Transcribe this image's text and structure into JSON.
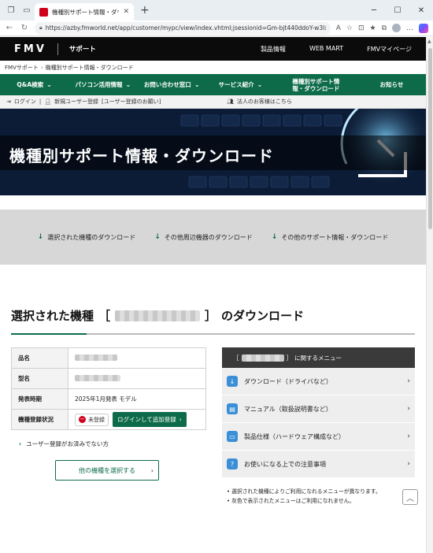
{
  "browser": {
    "tab_title": "機種別サポート情報・ダウンロード - FM",
    "url": "https://azby.fmworld.net/app/customer/mypc/view/index.vhtml;jsessionid=Gm-bjt440ddoY-w3lxGj8Dmu..."
  },
  "header": {
    "logo": "FMV",
    "support_label": "サポート",
    "links": [
      "製品情報",
      "WEB MART",
      "FMVマイページ"
    ]
  },
  "breadcrumb": [
    "FMVサポート",
    "機種別サポート情報・ダウンロード"
  ],
  "global_nav": [
    {
      "label": "Q&A検索",
      "has_chevron": true
    },
    {
      "label": "パソコン活用情報",
      "has_chevron": true
    },
    {
      "label": "お問い合わせ窓口",
      "has_chevron": true
    },
    {
      "label": "サービス紹介",
      "has_chevron": true
    },
    {
      "label": "機種別サポート情報・ダウンロード",
      "has_chevron": false
    },
    {
      "label": "お知らせ",
      "has_chevron": false
    }
  ],
  "user_bar": {
    "login": "ログイン",
    "separator": "|",
    "register": "新規ユーザー登録",
    "register_note": "[ユーザー登録のお願い]",
    "corporate": "法人のお客様はこちら"
  },
  "hero": {
    "title": "機種別サポート情報・ダウンロード"
  },
  "anchors": [
    "選択された機種のダウンロード",
    "その他周辺機器のダウンロード",
    "その他のサポート情報・ダウンロード"
  ],
  "section": {
    "title_prefix": "選択された機種",
    "bracket_open": "［",
    "bracket_close": "］",
    "title_suffix": "のダウンロード"
  },
  "spec_table": {
    "rows": [
      {
        "label": "品名",
        "value": ""
      },
      {
        "label": "型名",
        "value": ""
      },
      {
        "label": "発表時期",
        "value": "2025年1月発表 モデル"
      },
      {
        "label": "機種登録状況",
        "value": ""
      }
    ],
    "unregistered": "未登録",
    "login_button": "ログインして追加登録"
  },
  "hint": "ユーザー登録がお済みでない方",
  "other_model_button": "他の機種を選択する",
  "side_menu": {
    "title_open": "［",
    "title_close": "］",
    "title_suffix": "に関するメニュー",
    "items": [
      "ダウンロード（ドライバなど）",
      "マニュアル（取扱説明書など）",
      "製品仕様（ハードウェア構成など）",
      "お使いになる上での注意事項"
    ],
    "notes": [
      "選択された機種によりご利用になれるメニューが異なります。",
      "灰色で表示されたメニューはご利用になれません。"
    ]
  },
  "colors": {
    "brand_green": "#0d6b4a",
    "header_black": "#0b0b0b",
    "alert_red": "#d0021b"
  }
}
